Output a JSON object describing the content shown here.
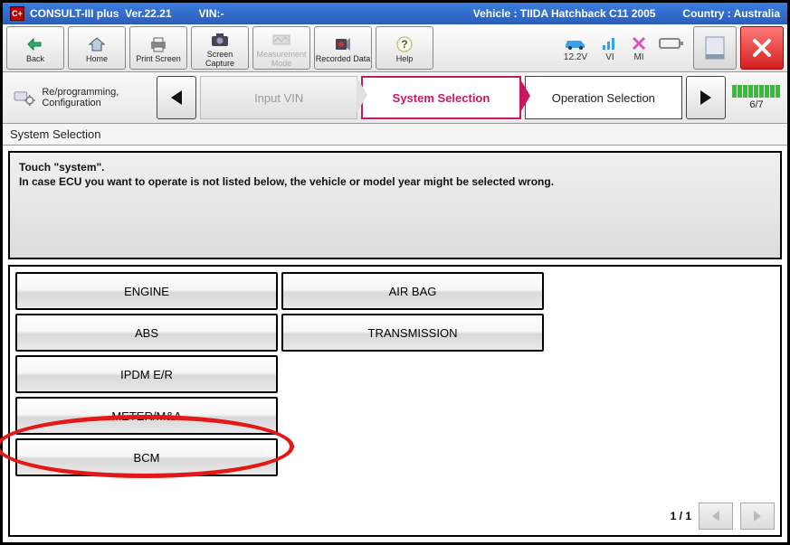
{
  "titlebar": {
    "app_icon_text": "C+",
    "app_name": "CONSULT-III plus",
    "version_label": "Ver.22.21",
    "vin_label": "VIN:-",
    "vehicle_label": "Vehicle : TIIDA Hatchback C11 2005",
    "country_label": "Country : Australia"
  },
  "toolbar": {
    "back": "Back",
    "home": "Home",
    "print": "Print Screen",
    "capture": "Screen Capture",
    "measure": "Measurement Mode",
    "recorded": "Recorded Data",
    "help": "Help",
    "voltage": "12.2V",
    "vi": "VI",
    "mi": "MI"
  },
  "breadcrumb": {
    "mode": "Re/programming, Configuration",
    "step1": "Input VIN",
    "step2": "System Selection",
    "step3": "Operation Selection",
    "progress": "6/7"
  },
  "subheader": "System Selection",
  "instruction": {
    "line1": "Touch \"system\".",
    "line2": "In case ECU you want to operate is not listed below, the vehicle or model year might be selected wrong."
  },
  "systems": {
    "engine": "ENGINE",
    "airbag": "AIR BAG",
    "abs": "ABS",
    "transmission": "TRANSMISSION",
    "ipdm": "IPDM E/R",
    "meter": "METER/M&A",
    "bcm": "BCM"
  },
  "pagination": "1 / 1"
}
